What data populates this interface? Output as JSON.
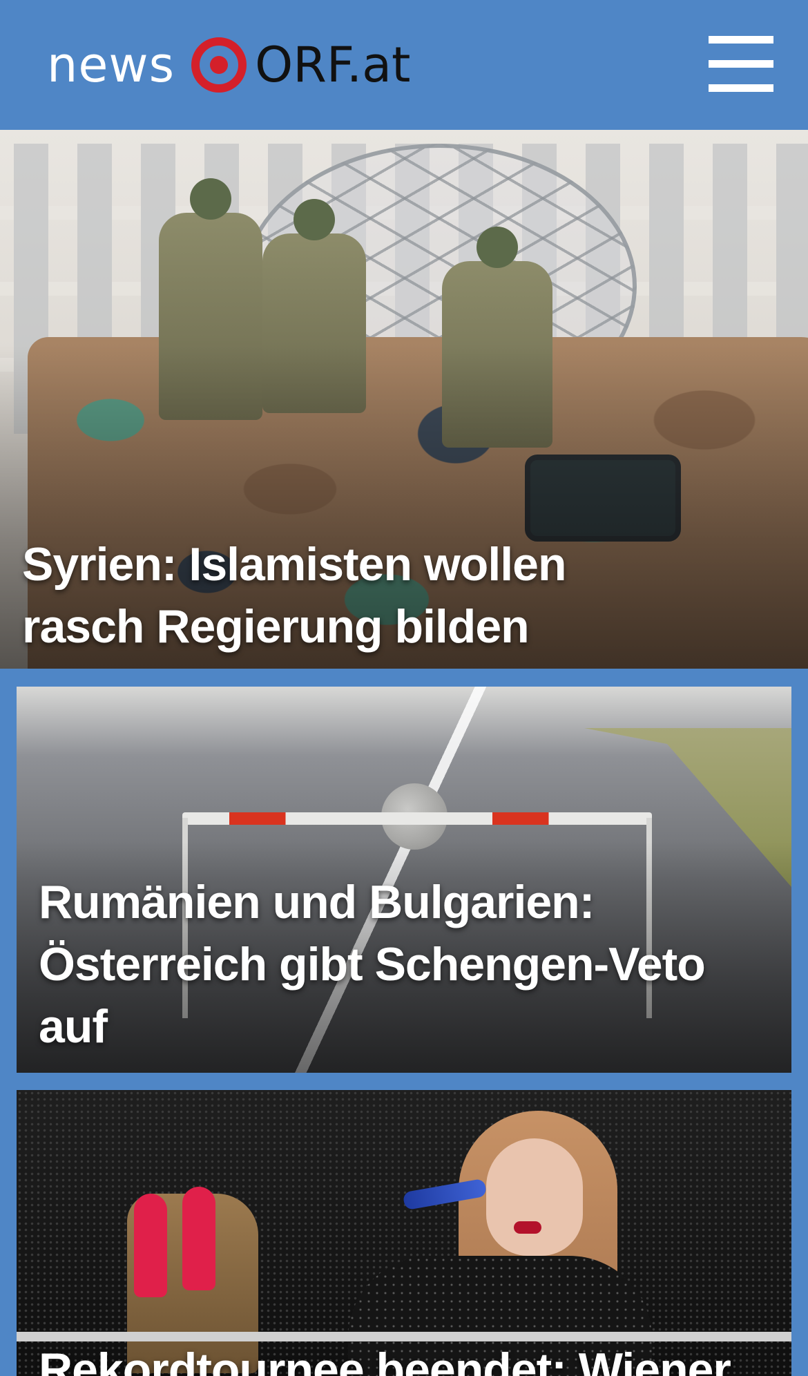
{
  "header": {
    "brand_news": "news",
    "brand_orf": "ORF.at",
    "brand_color": "#4f86c6",
    "logo_mark_color": "#d4202a",
    "menu_icon": "hamburger-menu-icon"
  },
  "articles": [
    {
      "headline": "Syrien: Islamisten wollen rasch Regierung bilden"
    },
    {
      "headline": "Rumänien und Bulgarien: Österreich gibt Schengen-Veto auf"
    },
    {
      "headline": "Rekordtournee beendet: Wiener"
    }
  ]
}
